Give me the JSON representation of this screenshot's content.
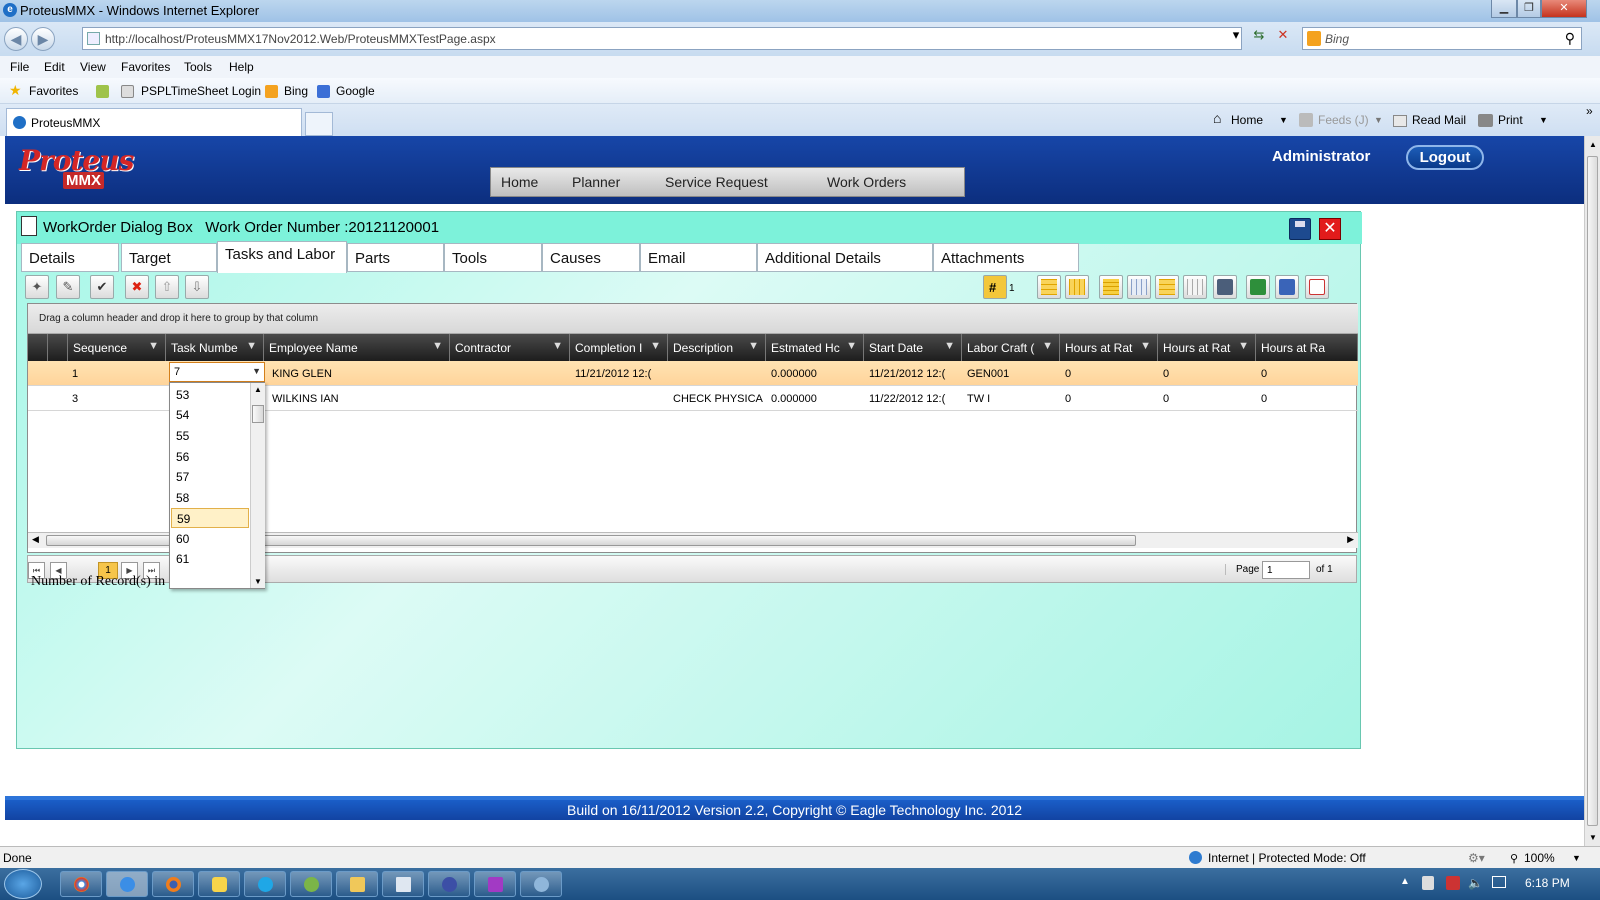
{
  "browser": {
    "window_title": "ProteusMMX - Windows Internet Explorer",
    "url": "http://localhost/ProteusMMX17Nov2012.Web/ProteusMMXTestPage.aspx",
    "search_placeholder": "Bing",
    "menu": [
      "File",
      "Edit",
      "View",
      "Favorites",
      "Tools",
      "Help"
    ],
    "favorites_label": "Favorites",
    "favorites_links": [
      "PSPLTimeSheet Login",
      "Bing",
      "Google"
    ],
    "tab_title": "ProteusMMX",
    "command_bar": {
      "home": "Home",
      "feeds": "Feeds (J)",
      "read_mail": "Read Mail",
      "print": "Print"
    },
    "status_left": "Done",
    "status_zone": "Internet | Protected Mode: Off",
    "zoom": "100%",
    "clock": "6:18 PM"
  },
  "app": {
    "logo_script": "Proteus",
    "logo_badge": "MMX",
    "nav": [
      "Home",
      "Planner",
      "Service Request",
      "Work Orders"
    ],
    "user": "Administrator",
    "logout": "Logout"
  },
  "dialog": {
    "title": "WorkOrder Dialog Box",
    "work_order_label": "Work Order Number :20121120001",
    "tabs": [
      "Details",
      "Target",
      "Tasks and Labor",
      "Parts",
      "Tools",
      "Causes",
      "Email",
      "Additional Details",
      "Attachments"
    ],
    "active_tab": "Tasks and Labor",
    "toolbar_count": "1"
  },
  "grid": {
    "group_hint": "Drag a column header and drop it here to group by that column",
    "columns": [
      "Sequence",
      "Task Numbe",
      "Employee Name",
      "Contractor",
      "Completion I",
      "Description",
      "Estmated Hc",
      "Start Date",
      "Labor Craft (",
      "Hours at Rat",
      "Hours at Rat",
      "Hours at Ra"
    ],
    "rows": [
      {
        "sequence": "1",
        "task": "7",
        "employee": "KING GLEN",
        "contractor": "",
        "completion": "11/21/2012 12:(",
        "description": "",
        "estimated": "0.000000",
        "start": "11/21/2012 12:(",
        "craft": "GEN001",
        "h1": "0",
        "h2": "0",
        "h3": "0"
      },
      {
        "sequence": "3",
        "task": "",
        "employee": "WILKINS IAN",
        "contractor": "",
        "completion": "",
        "description": "CHECK PHYSICA",
        "estimated": "0.000000",
        "start": "11/22/2012 12:(",
        "craft": "TW I",
        "h1": "0",
        "h2": "0",
        "h3": "0"
      }
    ],
    "pager": {
      "current": "1",
      "page_label": "Page",
      "page_value": "1",
      "of_label": "of 1"
    },
    "records_label": "Number of Record(s) in Grid:  2"
  },
  "dropdown": {
    "value": "7",
    "options": [
      "53",
      "54",
      "55",
      "56",
      "57",
      "58",
      "59",
      "60",
      "61"
    ],
    "highlighted": "59"
  },
  "footer": "Build on 16/11/2012 Version 2.2, Copyright © Eagle Technology Inc. 2012"
}
